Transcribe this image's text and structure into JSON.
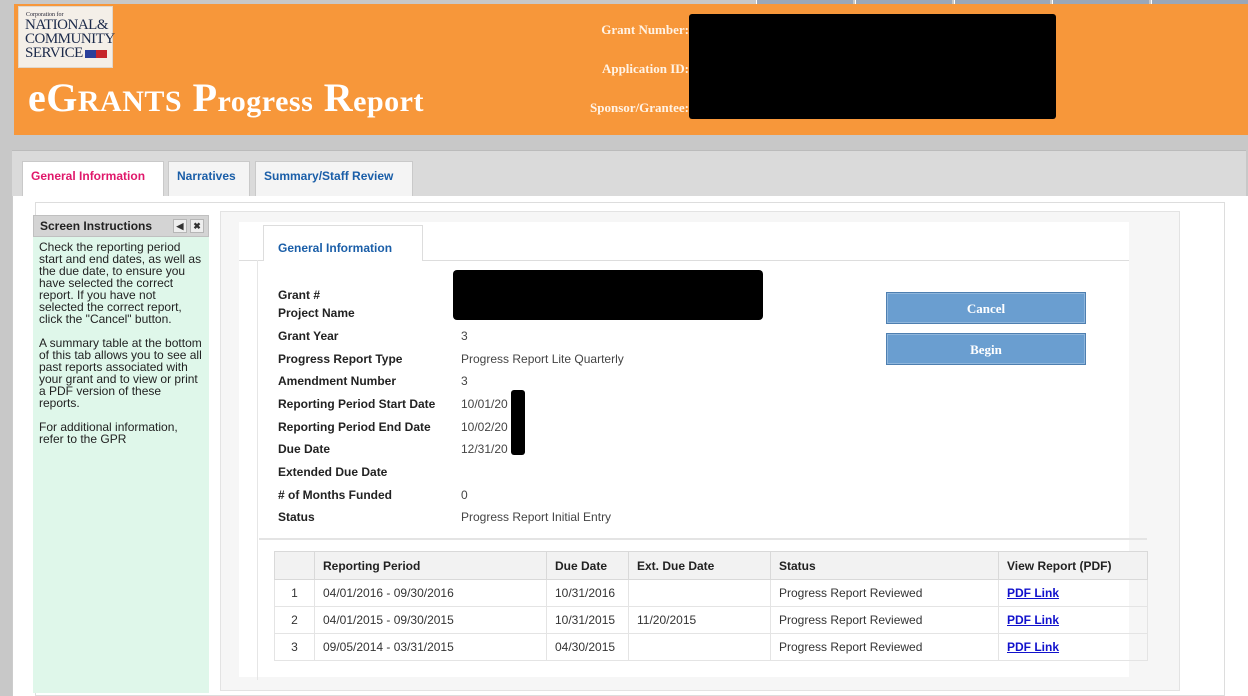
{
  "header": {
    "logo": {
      "small_text": "Corporation for",
      "line1": "NATIONAL&",
      "line2": "COMMUNITY",
      "line3": "SERVICE"
    },
    "title_part1": "e",
    "title_part2": "G",
    "title_part3": "RANTS",
    "title_part4": " P",
    "title_part5": "rogress",
    "title_part6": " R",
    "title_part7": "eport",
    "grant_number_label": "Grant Number:",
    "application_id_label": "Application ID:",
    "sponsor_label": "Sponsor/Grantee:"
  },
  "tabs": [
    {
      "label": "General Information",
      "active": true
    },
    {
      "label": "Narratives",
      "active": false
    },
    {
      "label": "Summary/Staff Review",
      "active": false
    }
  ],
  "instructions": {
    "title": "Screen Instructions",
    "paragraphs": [
      "Check the reporting period start and end dates, as well as the due date, to ensure you have selected the correct report. If you have not selected the correct report, click the \"Cancel\" button.",
      "A summary table at the bottom of this tab allows you to see all past reports associated with your grant and to view or print a PDF version of these reports.",
      "For additional information, refer to the GPR"
    ]
  },
  "general": {
    "tab_label": "General Information",
    "fields": [
      {
        "label": "Grant #",
        "value": ""
      },
      {
        "label": "Project Name",
        "value": ""
      },
      {
        "label": "Grant Year",
        "value": "3"
      },
      {
        "label": "Progress Report Type",
        "value": "Progress Report Lite Quarterly"
      },
      {
        "label": "Amendment Number",
        "value": "3"
      },
      {
        "label": "Reporting Period Start Date",
        "value": "10/01/20"
      },
      {
        "label": "Reporting Period End Date",
        "value": "10/02/20"
      },
      {
        "label": "Due Date",
        "value": "12/31/20"
      },
      {
        "label": "Extended Due Date",
        "value": ""
      },
      {
        "label": "# of Months Funded",
        "value": "0"
      },
      {
        "label": "Status",
        "value": "Progress Report Initial Entry"
      }
    ],
    "cancel_label": "Cancel",
    "begin_label": "Begin"
  },
  "reports": {
    "headers": [
      "",
      "Reporting Period",
      "Due Date",
      "Ext. Due Date",
      "Status",
      "View Report (PDF)"
    ],
    "rows": [
      {
        "num": "1",
        "period": "04/01/2016 - 09/30/2016",
        "due": "10/31/2016",
        "ext": "",
        "status": "Progress Report Reviewed",
        "link": "PDF Link"
      },
      {
        "num": "2",
        "period": "04/01/2015 - 09/30/2015",
        "due": "10/31/2015",
        "ext": "11/20/2015",
        "status": "Progress Report Reviewed",
        "link": "PDF Link"
      },
      {
        "num": "3",
        "period": "09/05/2014 - 03/31/2015",
        "due": "04/30/2015",
        "ext": "",
        "status": "Progress Report Reviewed",
        "link": "PDF Link"
      }
    ]
  },
  "colors": {
    "header_orange": "#f7973a",
    "active_tab_text": "#e0186b",
    "tab_text": "#1a5ea8",
    "button_blue": "#6a9ed0",
    "instructions_bg": "#dff7ea"
  }
}
